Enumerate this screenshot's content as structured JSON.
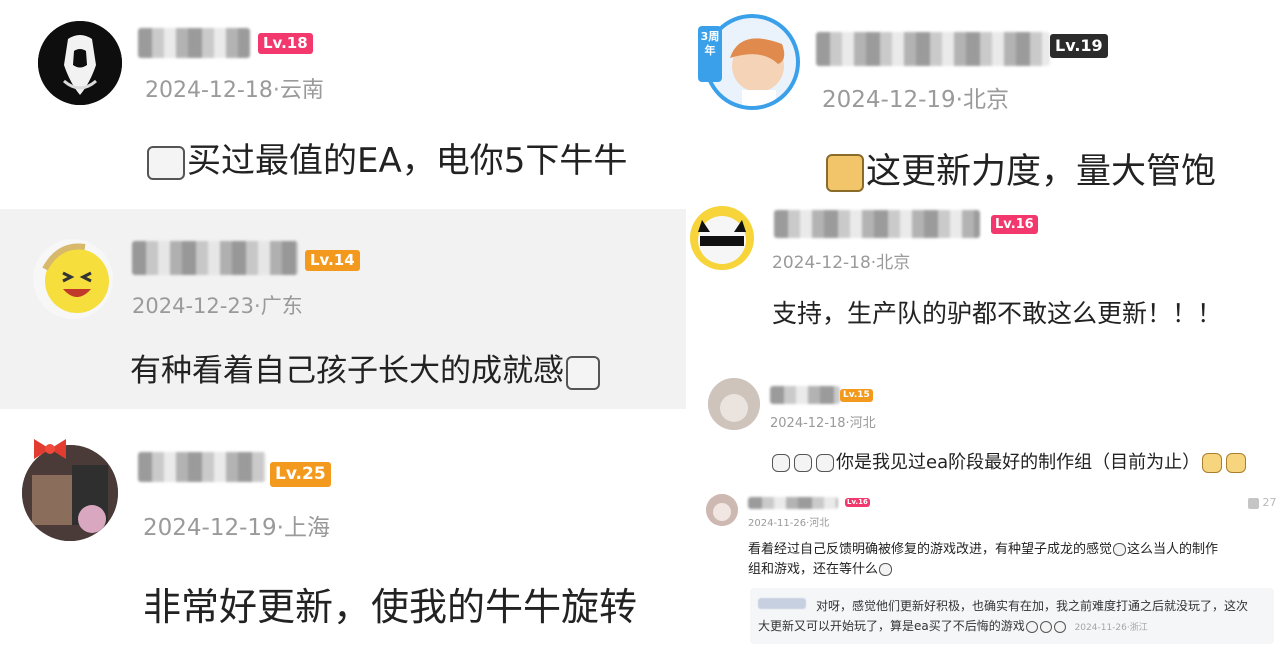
{
  "colors": {
    "lv_pink": "#f2386c",
    "lv_orange": "#f39a1e",
    "lv_dark": "#2b2b2b"
  },
  "comments": [
    {
      "level": "Lv.18",
      "date_location": "2024-12-18·云南",
      "text": "买过最值的EA，电你5下牛牛",
      "emoji": "crying-face-sticker"
    },
    {
      "level": "Lv.14",
      "date_location": "2024-12-23·广东",
      "text": "有种看着自己孩子长大的成就感",
      "emoji": "peeking-face-sticker"
    },
    {
      "level": "Lv.25",
      "date_location": "2024-12-19·上海",
      "text": "非常好更新，使我的牛牛旋转"
    },
    {
      "level": "Lv.19",
      "badge": "3周年",
      "date_location": "2024-12-19·北京",
      "text": "这更新力度，量大管饱",
      "emoji": "cat-face-sticker"
    },
    {
      "level": "Lv.16",
      "date_location": "2024-12-18·北京",
      "text": "支持，生产队的驴都不敢这么更新！！！"
    },
    {
      "level": "Lv.15",
      "date_location": "2024-12-18·河北",
      "text": "你是我见过ea阶段最好的制作组（目前为止）",
      "emoji": "peeking-face-stickers"
    },
    {
      "level": "Lv.16",
      "date_location": "2024-11-26·河北",
      "likes": "27",
      "text_line1": "看着经过自己反馈明确被修复的游戏改进，有种望子成龙的感觉",
      "text_line1b": "这么当人的制作",
      "text_line2": "组和游戏，还在等什么",
      "reply": {
        "line1": "对呀，感觉他们更新好积极，也确实有在加，我之前难度打通之后就没玩了，这次",
        "line2": "大更新又可以开始玩了，算是ea买了不后悔的游戏",
        "date_location": "2024-11-26·浙江"
      }
    }
  ]
}
